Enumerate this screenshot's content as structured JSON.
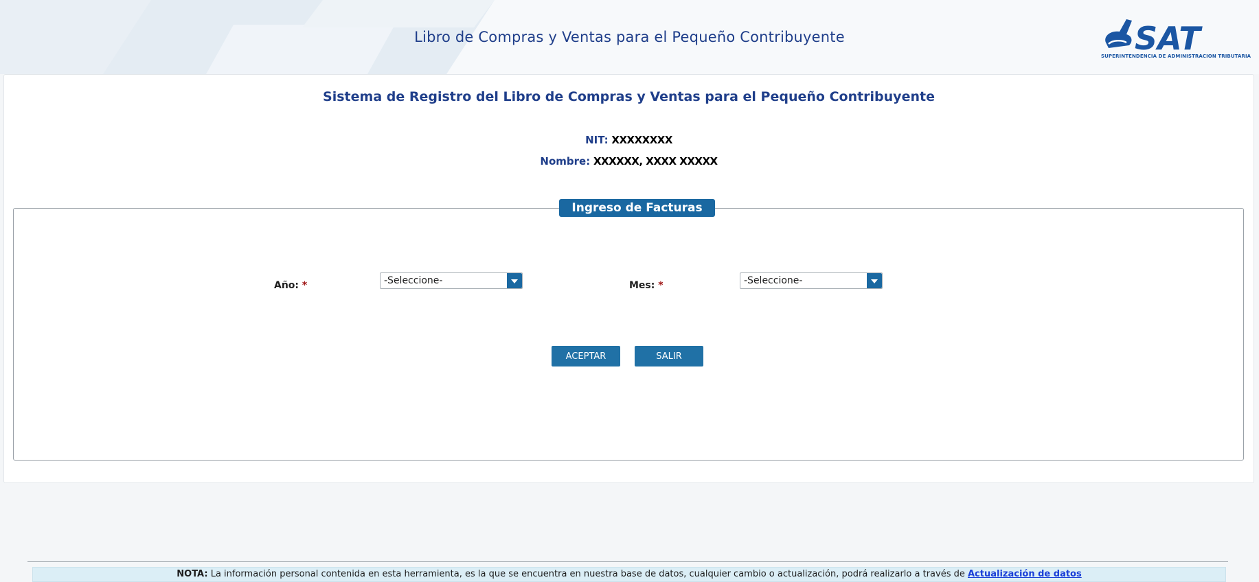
{
  "header": {
    "title": "Libro de Compras y Ventas para el Pequeño Contribuyente",
    "logo_text": "SAT",
    "logo_subtitle": "SUPERINTENDENCIA DE ADMINISTRACION TRIBUTARIA",
    "brand_color": "#1b56a3"
  },
  "main": {
    "system_title": "Sistema de Registro del Libro de Compras y Ventas para el Pequeño Contribuyente",
    "nit_label": "NIT:",
    "nit_value": "XXXXXXXX",
    "name_label": "Nombre:",
    "name_value": "XXXXXX, XXXX XXXXX"
  },
  "form": {
    "legend": "Ingreso de Facturas",
    "year_label": "Año:",
    "month_label": "Mes:",
    "required_mark": "*",
    "year_select_value": "-Seleccione-",
    "month_select_value": "-Seleccione-",
    "accept_button": "ACEPTAR",
    "exit_button": "SALIR"
  },
  "note": {
    "prefix": "NOTA:",
    "text": " La información personal contenida en esta herramienta, es la que se encuentra en nuestra base de datos, cualquier cambio o actualización, podrá realizarlo a través de ",
    "link_text": "Actualización de datos"
  },
  "colors": {
    "accent": "#1a68a1",
    "title": "#1f3e8a",
    "required": "#a01818",
    "note_bg": "#dbeef6",
    "link": "#1a3fd8"
  }
}
